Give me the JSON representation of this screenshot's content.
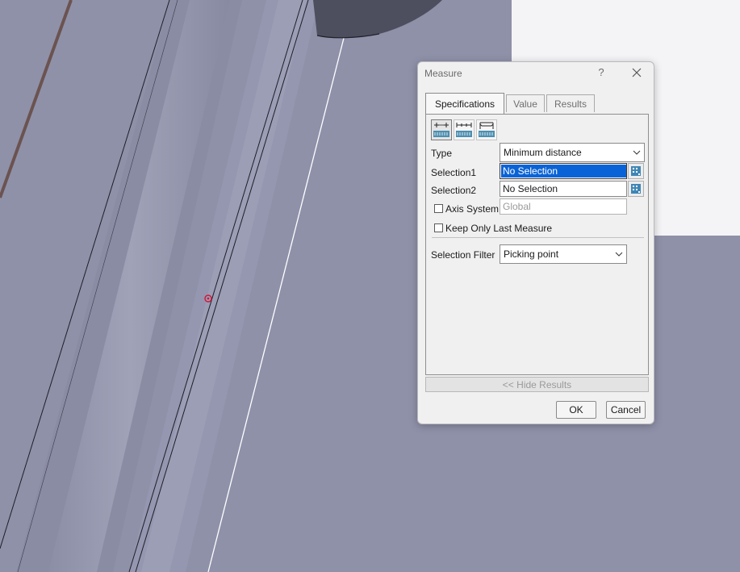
{
  "dialog": {
    "title": "Measure",
    "help": "?",
    "tabs": [
      {
        "label": "Specifications",
        "active": true
      },
      {
        "label": "Value",
        "active": false
      },
      {
        "label": "Results",
        "active": false
      }
    ],
    "mode_icons": [
      "measure-between-icon",
      "measure-item-icon",
      "measure-thickness-icon"
    ],
    "type": {
      "label": "Type",
      "value": "Minimum distance"
    },
    "selection1": {
      "label": "Selection1",
      "value": "No Selection"
    },
    "selection2": {
      "label": "Selection2",
      "value": "No Selection"
    },
    "axis_system": {
      "label": "Axis System",
      "checked": false,
      "value": "Global"
    },
    "keep_last": {
      "label": "Keep Only Last Measure",
      "checked": false
    },
    "selection_filter": {
      "label": "Selection Filter",
      "value": "Picking point"
    },
    "hide_results": "<< Hide Results",
    "ok": "OK",
    "cancel": "Cancel"
  },
  "colors": {
    "viewport_bg": "#8f91a9",
    "selection_highlight": "#0a63d6",
    "pick_marker": "#d4143a"
  }
}
